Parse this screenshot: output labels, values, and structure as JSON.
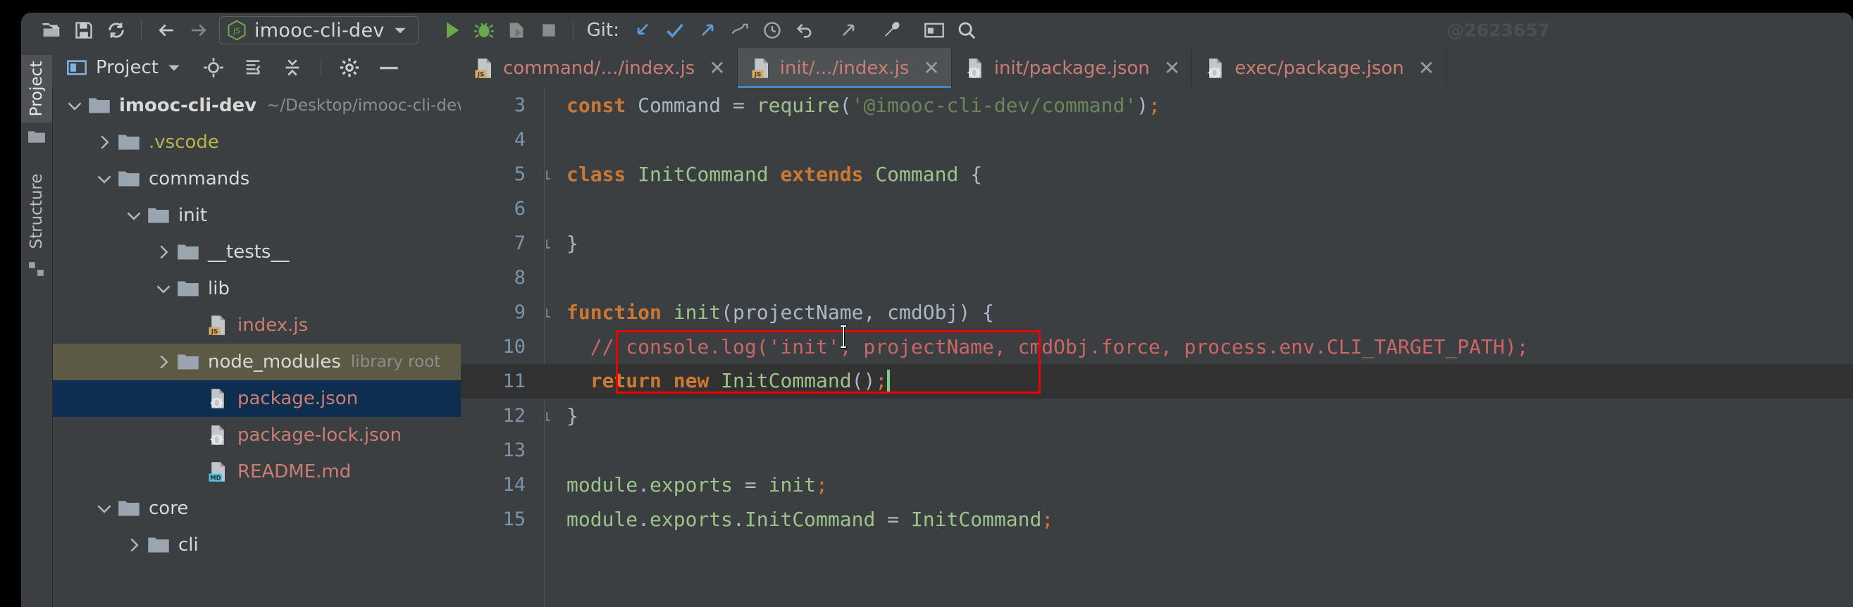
{
  "window": {
    "watermark": "@2623657",
    "background": "#3c3f41",
    "accent": "#4b82c3"
  },
  "toolbar": {
    "open_label": "open-folder-icon",
    "save_label": "save-icon",
    "sync_label": "sync-icon",
    "back_label": "back-arrow-icon",
    "forward_label": "forward-arrow-icon",
    "project_chip": "imooc-cli-dev",
    "run_label": "run-icon",
    "debug_label": "debug-icon",
    "coverage_label": "run-with-coverage-icon",
    "stop_label": "stop-icon",
    "git_label": "Git:",
    "git_update": "update-project-icon",
    "git_commit": "commit-icon",
    "git_push": "push-icon",
    "git_rollback_arrow": "revert-icon",
    "history": "history-icon",
    "undo": "undo-icon",
    "redo": "redo-icon",
    "settings": "wrench-icon",
    "terminal": "terminal-icon",
    "search": "search-everywhere-icon"
  },
  "tool_strip": {
    "project_tab": "Project",
    "structure_tab": "Structure"
  },
  "project_panel": {
    "title": "Project",
    "buttons": [
      "locate-icon",
      "expand-all-icon",
      "collapse-all-icon",
      "settings-gear-icon",
      "hide-icon"
    ]
  },
  "tree": [
    {
      "label": "imooc-cli-dev",
      "sub": "~/Desktop/imooc-cli-dev",
      "indent": 0,
      "arrow": "down",
      "icon": "folder",
      "color": "#d8d8d8",
      "state": "none",
      "bold": true
    },
    {
      "label": ".vscode",
      "sub": "",
      "indent": 1,
      "arrow": "right",
      "icon": "folder",
      "color": "#b5b54a",
      "state": "none",
      "bold": false
    },
    {
      "label": "commands",
      "sub": "",
      "indent": 1,
      "arrow": "down",
      "icon": "folder",
      "color": "#d8d8d8",
      "state": "none",
      "bold": false
    },
    {
      "label": "init",
      "sub": "",
      "indent": 2,
      "arrow": "down",
      "icon": "folder",
      "color": "#d8d8d8",
      "state": "none",
      "bold": false
    },
    {
      "label": "__tests__",
      "sub": "",
      "indent": 3,
      "arrow": "right",
      "icon": "folder",
      "color": "#d8d8d8",
      "state": "none",
      "bold": false
    },
    {
      "label": "lib",
      "sub": "",
      "indent": 3,
      "arrow": "down",
      "icon": "folder",
      "color": "#d8d8d8",
      "state": "none",
      "bold": false
    },
    {
      "label": "index.js",
      "sub": "",
      "indent": 4,
      "arrow": "none",
      "icon": "js",
      "color": "#cb7d73",
      "state": "none",
      "bold": false
    },
    {
      "label": "node_modules",
      "sub": "library root",
      "indent": 3,
      "arrow": "right",
      "icon": "folder",
      "color": "#d8d8d8",
      "state": "olive",
      "bold": false
    },
    {
      "label": "package.json",
      "sub": "",
      "indent": 4,
      "arrow": "none",
      "icon": "json",
      "color": "#cb7d73",
      "state": "blue",
      "bold": false
    },
    {
      "label": "package-lock.json",
      "sub": "",
      "indent": 4,
      "arrow": "none",
      "icon": "json",
      "color": "#cb7d73",
      "state": "none",
      "bold": false
    },
    {
      "label": "README.md",
      "sub": "",
      "indent": 4,
      "arrow": "none",
      "icon": "md",
      "color": "#cb7d73",
      "state": "none",
      "bold": false
    },
    {
      "label": "core",
      "sub": "",
      "indent": 1,
      "arrow": "down",
      "icon": "folder",
      "color": "#d8d8d8",
      "state": "none",
      "bold": false
    },
    {
      "label": "cli",
      "sub": "",
      "indent": 2,
      "arrow": "right",
      "icon": "folder",
      "color": "#d8d8d8",
      "state": "none",
      "bold": false
    }
  ],
  "editor_tabs": [
    {
      "label": "command/.../index.js",
      "icon": "js",
      "active": false
    },
    {
      "label": "init/.../index.js",
      "icon": "js",
      "active": true
    },
    {
      "label": "init/package.json",
      "icon": "json",
      "active": false
    },
    {
      "label": "exec/package.json",
      "icon": "json",
      "active": false
    }
  ],
  "code": {
    "lines": [
      {
        "n": "3",
        "fold": false,
        "hl": false,
        "tokens": [
          {
            "t": "const",
            "c": "kw"
          },
          {
            "t": " Command ",
            "c": "id"
          },
          {
            "t": "= ",
            "c": "pun"
          },
          {
            "t": "require",
            "c": "grn"
          },
          {
            "t": "(",
            "c": "pun"
          },
          {
            "t": "'@imooc-cli-dev/command'",
            "c": "str"
          },
          {
            "t": ")",
            "c": "pun"
          },
          {
            "t": ";",
            "c": "sem"
          }
        ]
      },
      {
        "n": "4",
        "fold": false,
        "hl": false,
        "tokens": []
      },
      {
        "n": "5",
        "fold": true,
        "hl": false,
        "tokens": [
          {
            "t": "class",
            "c": "kw"
          },
          {
            "t": " InitCommand ",
            "c": "grn"
          },
          {
            "t": "extends",
            "c": "kw"
          },
          {
            "t": " Command ",
            "c": "grn"
          },
          {
            "t": "{",
            "c": "pun"
          }
        ]
      },
      {
        "n": "6",
        "fold": false,
        "hl": false,
        "tokens": []
      },
      {
        "n": "7",
        "fold": true,
        "hl": false,
        "tokens": [
          {
            "t": "}",
            "c": "pun"
          }
        ]
      },
      {
        "n": "8",
        "fold": false,
        "hl": false,
        "tokens": []
      },
      {
        "n": "9",
        "fold": true,
        "hl": false,
        "tokens": [
          {
            "t": "function",
            "c": "kw"
          },
          {
            "t": " init",
            "c": "grn"
          },
          {
            "t": "(",
            "c": "pun"
          },
          {
            "t": "projectName, cmdObj",
            "c": "id"
          },
          {
            "t": ") ",
            "c": "pun"
          },
          {
            "t": "{",
            "c": "pun"
          }
        ]
      },
      {
        "n": "10",
        "fold": false,
        "hl": false,
        "tokens": [
          {
            "t": "  // console.log('init', projectName, cmdObj.force, process.env.CLI_TARGET_PATH);",
            "c": "cmt"
          }
        ]
      },
      {
        "n": "11",
        "fold": false,
        "hl": true,
        "tokens": [
          {
            "t": "  ",
            "c": "pun"
          },
          {
            "t": "return",
            "c": "kw"
          },
          {
            "t": " ",
            "c": "pun"
          },
          {
            "t": "new",
            "c": "kw"
          },
          {
            "t": " InitCommand",
            "c": "grn"
          },
          {
            "t": "()",
            "c": "pun"
          },
          {
            "t": ";",
            "c": "sem"
          }
        ],
        "caret": true
      },
      {
        "n": "12",
        "fold": true,
        "hl": false,
        "tokens": [
          {
            "t": "}",
            "c": "pun"
          }
        ]
      },
      {
        "n": "13",
        "fold": false,
        "hl": false,
        "tokens": []
      },
      {
        "n": "14",
        "fold": false,
        "hl": false,
        "tokens": [
          {
            "t": "module",
            "c": "grn"
          },
          {
            "t": ".",
            "c": "pun"
          },
          {
            "t": "exports ",
            "c": "grn"
          },
          {
            "t": "= ",
            "c": "pun"
          },
          {
            "t": "init",
            "c": "grn"
          },
          {
            "t": ";",
            "c": "sem"
          }
        ]
      },
      {
        "n": "15",
        "fold": false,
        "hl": false,
        "tokens": [
          {
            "t": "module",
            "c": "grn"
          },
          {
            "t": ".",
            "c": "pun"
          },
          {
            "t": "exports",
            "c": "grn"
          },
          {
            "t": ".",
            "c": "pun"
          },
          {
            "t": "InitCommand ",
            "c": "grn"
          },
          {
            "t": "= ",
            "c": "pun"
          },
          {
            "t": "InitCommand",
            "c": "grn"
          },
          {
            "t": ";",
            "c": "sem"
          }
        ]
      }
    ],
    "annotation_color": "#ef0000",
    "caret_color": "#7ed07e"
  }
}
